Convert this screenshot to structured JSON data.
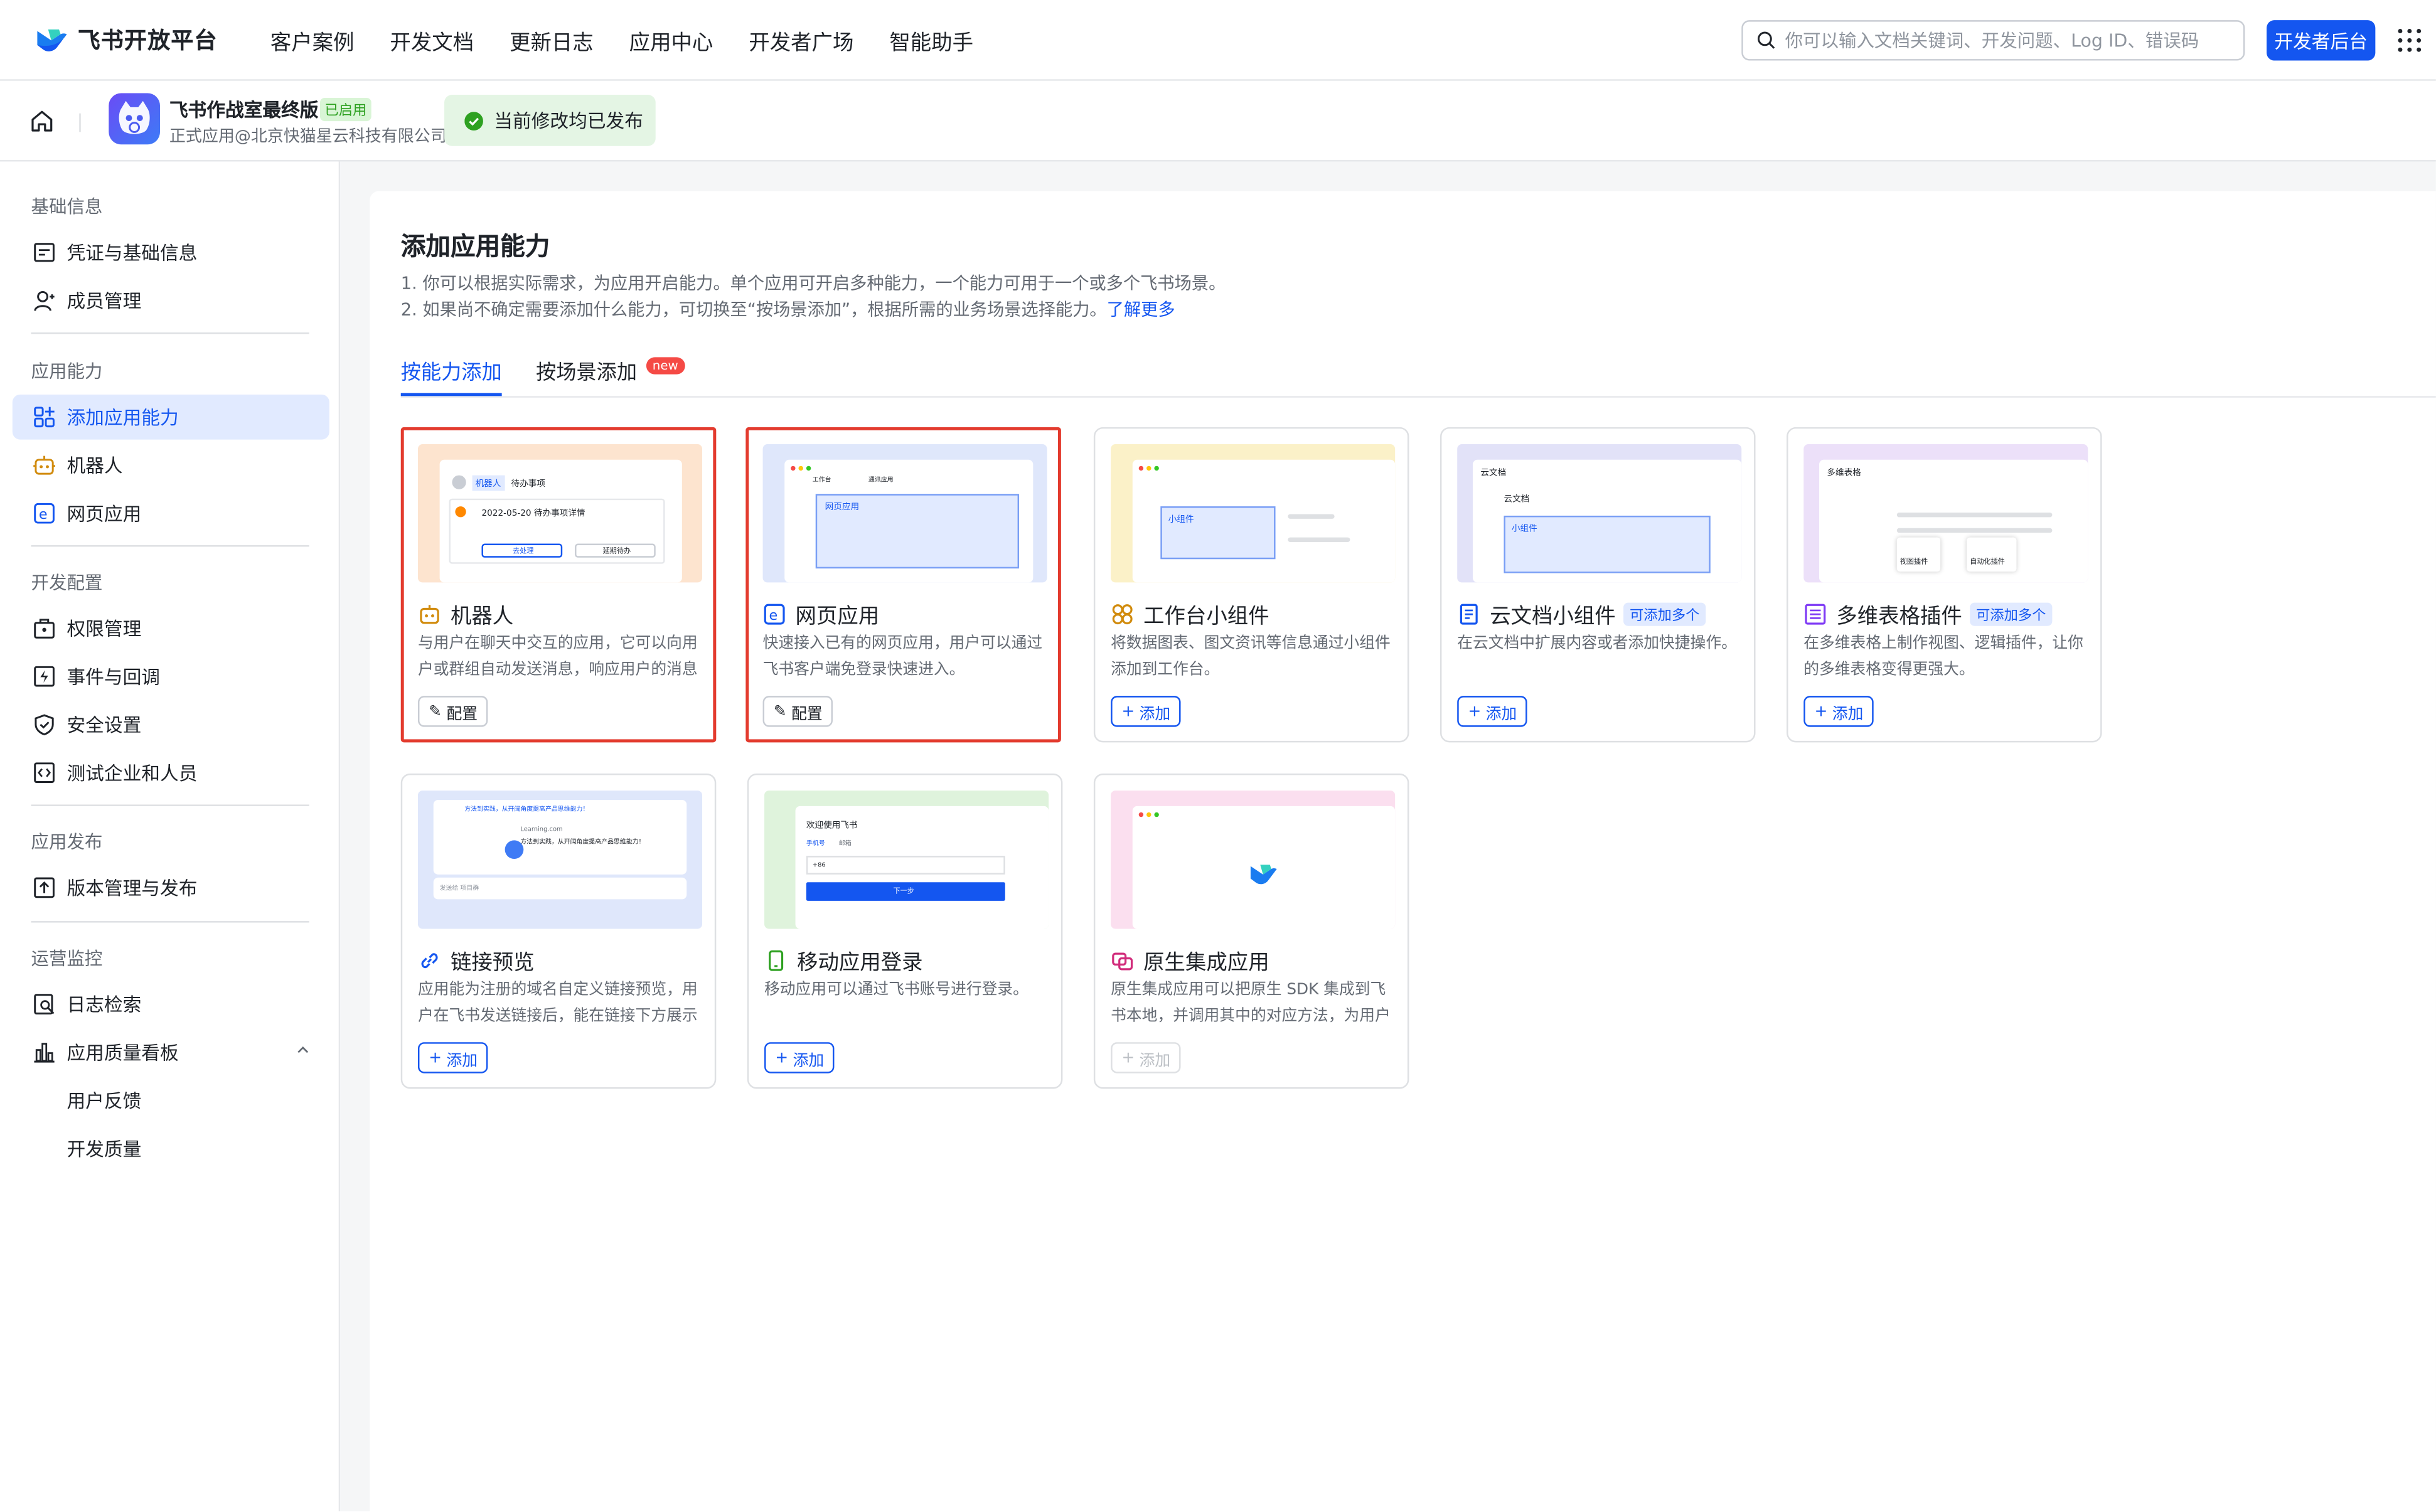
{
  "topnav": {
    "brand": "飞书开放平台",
    "items": [
      "客户案例",
      "开发文档",
      "更新日志",
      "应用中心",
      "开发者广场",
      "智能助手"
    ],
    "search_placeholder": "你可以输入文档关键词、开发问题、Log ID、错误码",
    "dev_console": "开发者后台"
  },
  "appbar": {
    "app_name": "飞书作战室最终版",
    "app_status": "已启用",
    "app_org": "正式应用@北京快猫星云科技有限公司",
    "publish_status": "当前修改均已发布"
  },
  "sidebar": {
    "groups": [
      "基础信息",
      "应用能力",
      "开发配置",
      "应用发布",
      "运营监控"
    ],
    "items": [
      {
        "label": "凭证与基础信息",
        "icon": "id-card-icon"
      },
      {
        "label": "成员管理",
        "icon": "member-icon"
      },
      {
        "label": "添加应用能力",
        "icon": "add-app-icon"
      },
      {
        "label": "机器人",
        "icon": "robot-icon"
      },
      {
        "label": "网页应用",
        "icon": "web-app-icon"
      },
      {
        "label": "权限管理",
        "icon": "permission-icon"
      },
      {
        "label": "事件与回调",
        "icon": "event-icon"
      },
      {
        "label": "安全设置",
        "icon": "shield-icon"
      },
      {
        "label": "测试企业和人员",
        "icon": "test-icon"
      },
      {
        "label": "版本管理与发布",
        "icon": "upload-icon"
      },
      {
        "label": "日志检索",
        "icon": "log-search-icon"
      },
      {
        "label": "应用质量看板",
        "icon": "bar-chart-icon"
      },
      {
        "label": "用户反馈",
        "icon": ""
      },
      {
        "label": "开发质量",
        "icon": ""
      }
    ]
  },
  "main": {
    "title": "添加应用能力",
    "desc1": "1. 你可以根据实际需求，为应用开启能力。单个应用可开启多种能力，一个能力可用于一个或多个飞书场景。",
    "desc2": "2. 如果尚不确定需要添加什么能力，可切换至“按场景添加”，根据所需的业务场景选择能力。",
    "learn_more": "了解更多",
    "tabs": [
      "按能力添加",
      "按场景添加"
    ],
    "new_badge": "new"
  },
  "cards": [
    {
      "title": "机器人",
      "desc": "与用户在聊天中交互的应用，它可以向用户或群组自动发送消息，响应用户的消息",
      "button": "配置",
      "icon": "robot-icon",
      "highlighted": true
    },
    {
      "title": "网页应用",
      "desc": "快速接入已有的网页应用，用户可以通过飞书客户端免登录快速进入。",
      "button": "配置",
      "icon": "web-app-icon",
      "highlighted": true
    },
    {
      "title": "工作台小组件",
      "desc": "将数据图表、图文资讯等信息通过小组件添加到工作台。",
      "button": "添加",
      "icon": "widget-icon"
    },
    {
      "title": "云文档小组件",
      "badge": "可添加多个",
      "desc": "在云文档中扩展内容或者添加快捷操作。",
      "button": "添加",
      "icon": "doc-icon"
    },
    {
      "title": "多维表格插件",
      "badge": "可添加多个",
      "desc": "在多维表格上制作视图、逻辑插件，让你的多维表格变得更强大。",
      "button": "添加",
      "icon": "bitable-icon"
    },
    {
      "title": "链接预览",
      "desc": "应用能为注册的域名自定义链接预览，用户在飞书发送链接后，能在链接下方展示预览",
      "button": "添加",
      "icon": "link-icon"
    },
    {
      "title": "移动应用登录",
      "desc": "移动应用可以通过飞书账号进行登录。",
      "button": "添加",
      "icon": "mobile-icon"
    },
    {
      "title": "原生集成应用",
      "desc": "原生集成应用可以把原生 SDK 集成到飞书本地，并调用其中的对应方法，为用户提供服务",
      "button": "添加",
      "icon": "native-icon",
      "disabled": true
    }
  ],
  "thumbs": {
    "robot": {
      "tag": "机器人",
      "tag2": "待办事项",
      "line": "2022-05-20 待办事项详情",
      "b1": "去处理",
      "b2": "延期待办"
    },
    "web": {
      "tab1": "工作台",
      "tab2": "通讯应用",
      "panel": "网页应用"
    },
    "widget": {
      "panel": "小组件"
    },
    "doc": {
      "head": "云文档",
      "sub": "云文档",
      "panel": "小组件"
    },
    "bitable": {
      "head": "多维表格",
      "b1": "视图插件",
      "b2": "自动化插件"
    },
    "link": {
      "msg": "方法到实践，从开阔角度提高产品思维能力！",
      "domain": "Learning.com",
      "msg2": "方法到实践，从开阔角度提高产品思维能力！",
      "input": "发送给 项目群"
    },
    "mobile": {
      "head": "欢迎使用飞书",
      "t1": "手机号",
      "t2": "邮箱",
      "code": "+86",
      "btn": "下一步"
    }
  },
  "colors": {
    "primary": "#1456f0",
    "highlight": "#e33b2e",
    "success": "#2ea121"
  }
}
